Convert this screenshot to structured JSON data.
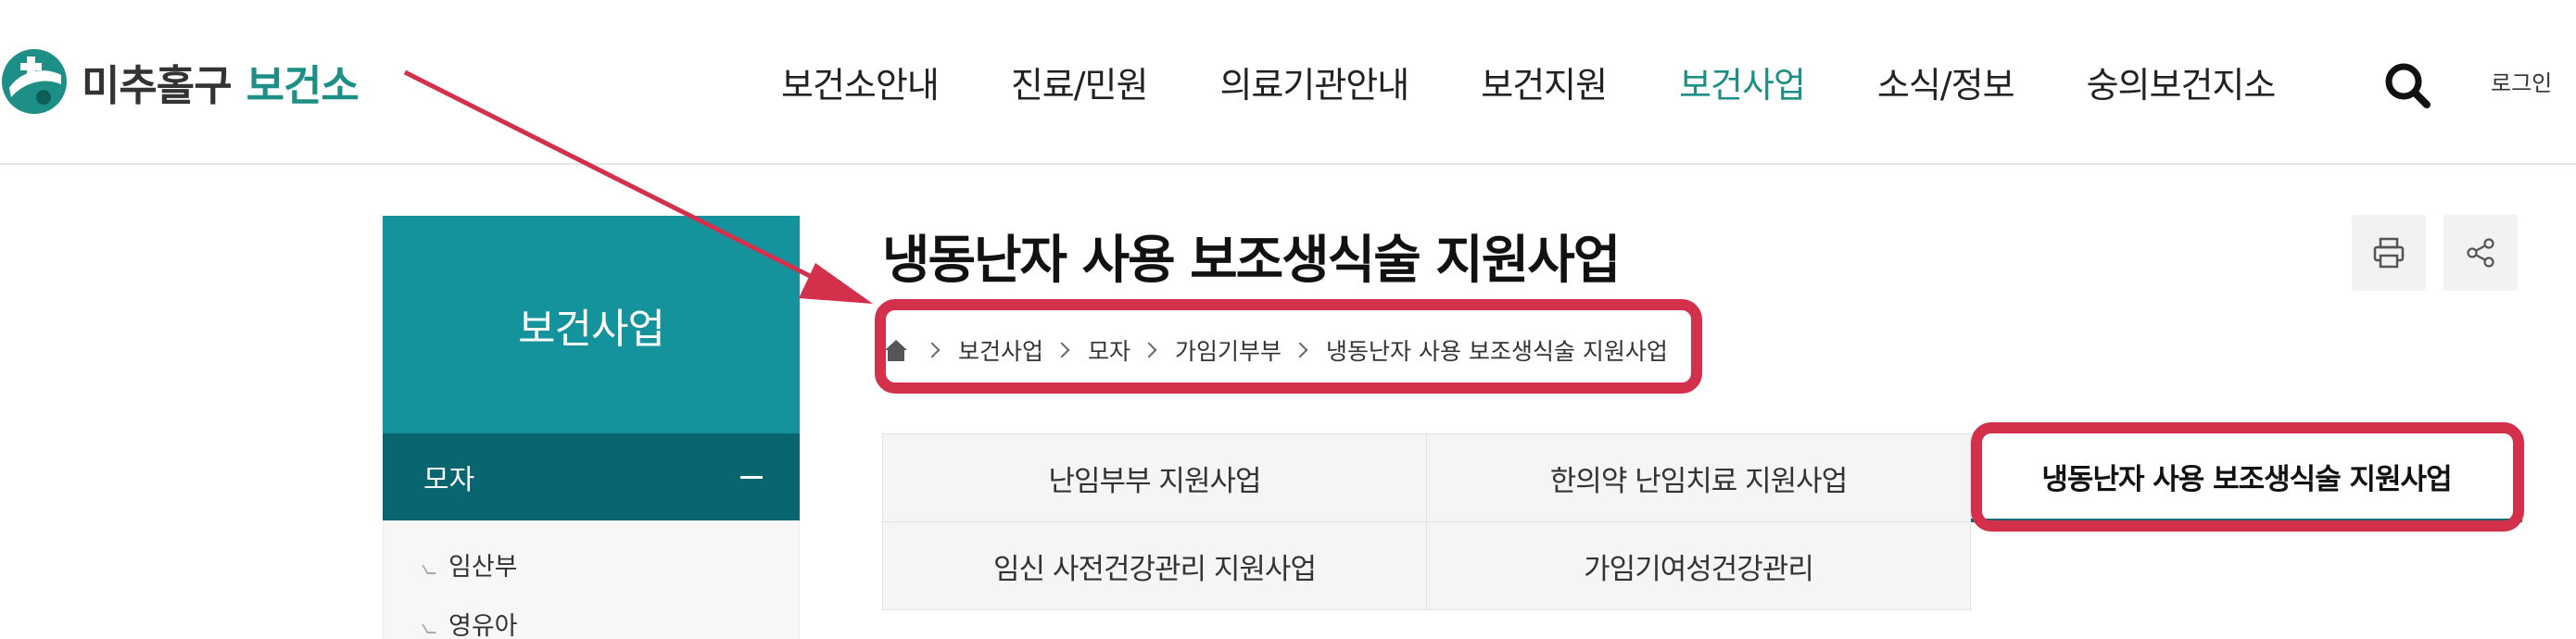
{
  "header": {
    "logo_text_a": "미추홀구",
    "logo_text_b": "보건소",
    "nav": [
      {
        "label": "보건소안내"
      },
      {
        "label": "진료/민원"
      },
      {
        "label": "의료기관안내"
      },
      {
        "label": "보건지원"
      },
      {
        "label": "보건사업"
      },
      {
        "label": "소식/정보"
      },
      {
        "label": "숭의보건지소"
      }
    ],
    "active_nav_index": 4,
    "login_label": "로그인"
  },
  "sidebar": {
    "title": "보건사업",
    "section_label": "모자",
    "items": [
      {
        "label": "임산부"
      },
      {
        "label": "영유아"
      }
    ]
  },
  "main": {
    "page_title": "냉동난자 사용 보조생식술 지원사업",
    "breadcrumb": [
      "보건사업",
      "모자",
      "가임기부부",
      "냉동난자 사용 보조생식술 지원사업"
    ],
    "tabs": [
      {
        "label": "난임부부 지원사업"
      },
      {
        "label": "한의약 난임치료 지원사업"
      },
      {
        "label": "냉동난자 사용 보조생식술 지원사업"
      },
      {
        "label": "임신 사전건강관리 지원사업"
      },
      {
        "label": "가임기여성건강관리"
      }
    ],
    "active_tab_index": 2
  },
  "icons": {
    "search": "search-icon",
    "print": "print-icon",
    "share": "share-icon",
    "home": "home-icon"
  },
  "colors": {
    "brand": "#1d8f86",
    "sidebar_top": "#14939c",
    "sidebar_section": "#09656f",
    "annotation": "#d3304b"
  }
}
